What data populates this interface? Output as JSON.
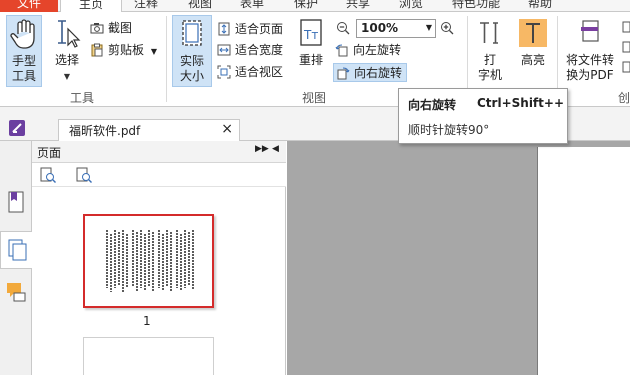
{
  "tabs": {
    "file": "文件",
    "home": "主页",
    "annotate": "注释",
    "view": "视图",
    "form": "表单",
    "protect": "保护",
    "share": "共享",
    "browse": "浏览",
    "features": "特色功能",
    "help": "帮助"
  },
  "tools_group": {
    "hand_label": "手型\n工具",
    "select_label": "选择",
    "snapshot_label": "截图",
    "clipboard_label": "剪贴板",
    "group_label": "工具"
  },
  "view_group": {
    "actual_size_label": "实际\n大小",
    "fit_page": "适合页面",
    "fit_width": "适合宽度",
    "fit_visible": "适合视区",
    "reflow_label": "重排",
    "zoom_value": "100%",
    "rotate_left": "向左旋转",
    "rotate_right": "向右旋转",
    "group_label": "视图"
  },
  "other_group": {
    "typewriter_label": "打\n字机",
    "highlight_label": "高亮",
    "convert_label": "将文件转\n换为PDF",
    "create_label_partial": "创"
  },
  "tooltip": {
    "title": "向右旋转",
    "shortcut": "Ctrl+Shift++",
    "description": "顺时针旋转90°"
  },
  "document_tab": {
    "filename": "福昕软件.pdf",
    "close": "×"
  },
  "pages_panel": {
    "title": "页面",
    "page_number": "1"
  },
  "colors": {
    "file_tab": "#e5452b",
    "selection_blue": "#cfe3f6",
    "highlight_orange": "#f7b865",
    "thumb_border": "#d42b2b",
    "canvas_gray": "#a7a7a7"
  }
}
